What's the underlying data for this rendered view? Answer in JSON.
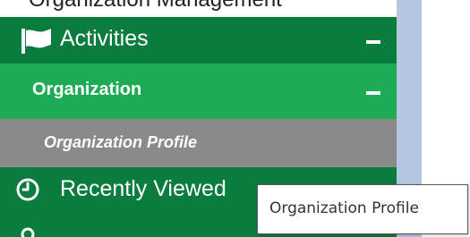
{
  "top_cut_text": "Organization Management",
  "sidebar": {
    "items": [
      {
        "label": "Activities",
        "icon": "flag-icon",
        "state": "expanded",
        "toggle_icon": "collapse-icon"
      },
      {
        "label": "Organization",
        "state": "expanded",
        "toggle_icon": "collapse-icon"
      },
      {
        "label": "Organization Profile",
        "state": "selected"
      },
      {
        "label": "Recently Viewed",
        "icon": "clock-icon"
      }
    ]
  },
  "tooltip": {
    "text": "Organization Profile"
  },
  "colors": {
    "sidebar_dark_green": "#0a7c3e",
    "sidebar_light_green": "#1dab55",
    "selected_gray": "#8a8a8a",
    "scroll_rail": "#b5c6e3"
  }
}
